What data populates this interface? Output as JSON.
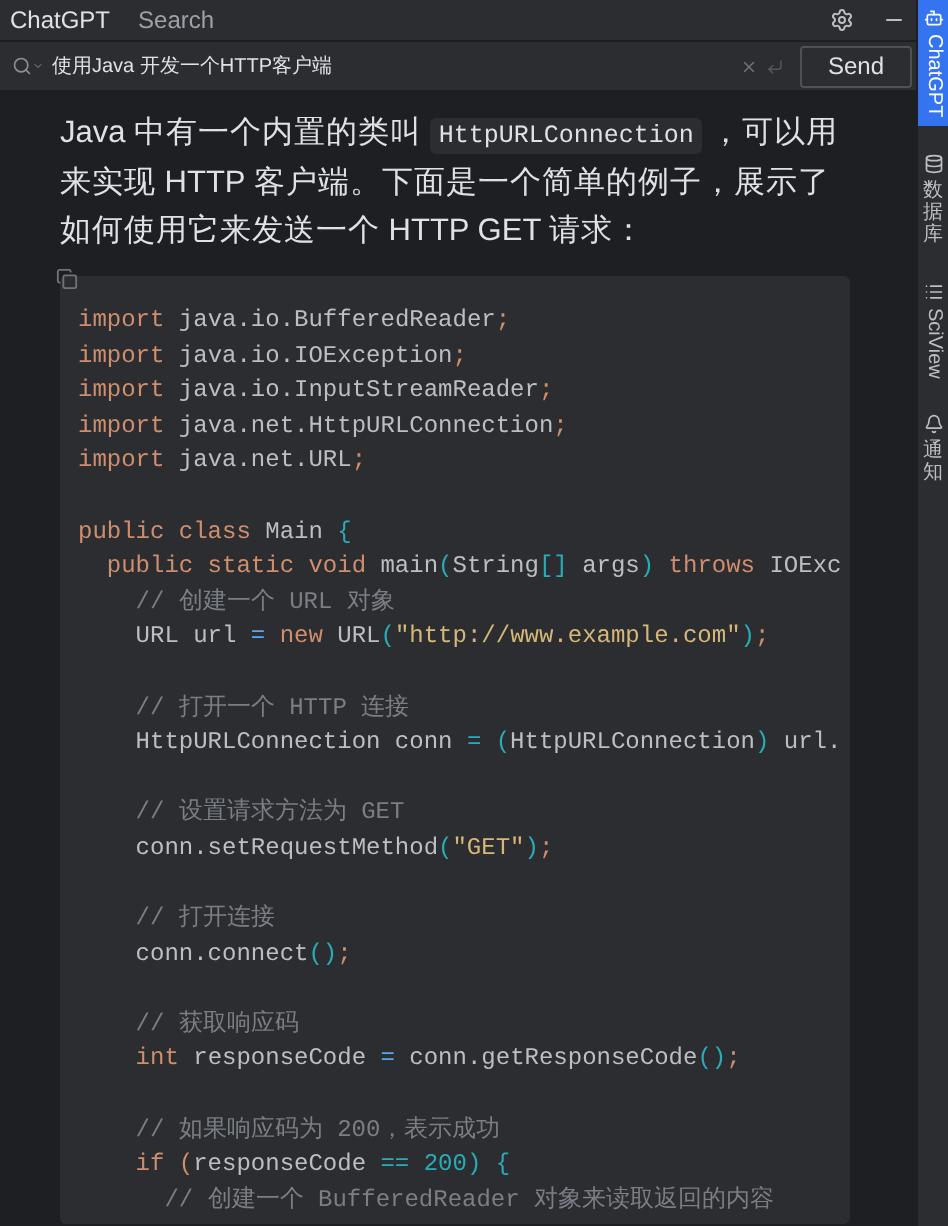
{
  "header": {
    "tabs": [
      {
        "label": "ChatGPT",
        "selected": true
      },
      {
        "label": "Search",
        "selected": false
      }
    ]
  },
  "search": {
    "value": "使用Java 开发一个HTTP客户端",
    "send": "Send"
  },
  "message": {
    "paragraph": [
      {
        "kind": "text",
        "text": "Java 中有一个内置的类叫 "
      },
      {
        "kind": "code",
        "text": "HttpURLConnection"
      },
      {
        "kind": "text",
        "text": " ，可以用来实现 HTTP 客户端。下面是一个简单的例子，展示了如何使用它来发送一个 HTTP GET 请求："
      }
    ],
    "code_lines": [
      {
        "kind": "code",
        "tokens": [
          {
            "text": "import",
            "kind": "kw"
          },
          {
            "text": " java.io.BufferedReader",
            "kind": "id"
          },
          {
            "text": ";",
            "kind": "pn"
          }
        ]
      },
      {
        "kind": "code",
        "tokens": [
          {
            "text": "import",
            "kind": "kw"
          },
          {
            "text": " java.io.IOException",
            "kind": "id"
          },
          {
            "text": ";",
            "kind": "pn"
          }
        ]
      },
      {
        "kind": "code",
        "tokens": [
          {
            "text": "import",
            "kind": "kw"
          },
          {
            "text": " java.io.InputStreamReader",
            "kind": "id"
          },
          {
            "text": ";",
            "kind": "pn"
          }
        ]
      },
      {
        "kind": "code",
        "tokens": [
          {
            "text": "import",
            "kind": "kw"
          },
          {
            "text": " java.net.HttpURLConnection",
            "kind": "id"
          },
          {
            "text": ";",
            "kind": "pn"
          }
        ]
      },
      {
        "kind": "code",
        "tokens": [
          {
            "text": "import",
            "kind": "kw"
          },
          {
            "text": " java.net.URL",
            "kind": "id"
          },
          {
            "text": ";",
            "kind": "pn"
          }
        ]
      },
      {
        "kind": "blank"
      },
      {
        "kind": "code",
        "tokens": [
          {
            "text": "public class",
            "kind": "kw"
          },
          {
            "text": " Main ",
            "kind": "id"
          },
          {
            "text": "{",
            "kind": "br"
          }
        ]
      },
      {
        "kind": "code",
        "tokens": [
          {
            "text": "  public static void",
            "kind": "kw"
          },
          {
            "text": " main",
            "kind": "id"
          },
          {
            "text": "(",
            "kind": "br"
          },
          {
            "text": "String",
            "kind": "id"
          },
          {
            "text": "[]",
            "kind": "br"
          },
          {
            "text": " args",
            "kind": "id"
          },
          {
            "text": ") ",
            "kind": "br"
          },
          {
            "text": "throws",
            "kind": "kw"
          },
          {
            "text": " IOExc",
            "kind": "id"
          }
        ]
      },
      {
        "kind": "code",
        "tokens": [
          {
            "text": "    // 创建一个 URL 对象",
            "kind": "cm"
          }
        ]
      },
      {
        "kind": "code",
        "tokens": [
          {
            "text": "    URL url ",
            "kind": "id"
          },
          {
            "text": "=",
            "kind": "op"
          },
          {
            "text": " new",
            "kind": "kw"
          },
          {
            "text": " URL",
            "kind": "id"
          },
          {
            "text": "(",
            "kind": "br"
          },
          {
            "text": "\"http://www.example.com\"",
            "kind": "str"
          },
          {
            "text": ")",
            "kind": "br"
          },
          {
            "text": ";",
            "kind": "pn"
          }
        ]
      },
      {
        "kind": "blank"
      },
      {
        "kind": "code",
        "tokens": [
          {
            "text": "    // 打开一个 HTTP 连接",
            "kind": "cm"
          }
        ]
      },
      {
        "kind": "code",
        "tokens": [
          {
            "text": "    HttpURLConnection conn ",
            "kind": "id"
          },
          {
            "text": "= (",
            "kind": "br"
          },
          {
            "text": "HttpURLConnection",
            "kind": "id"
          },
          {
            "text": ")",
            "kind": "br"
          },
          {
            "text": " url.",
            "kind": "id"
          }
        ]
      },
      {
        "kind": "blank"
      },
      {
        "kind": "code",
        "tokens": [
          {
            "text": "    // 设置请求方法为 GET",
            "kind": "cm"
          }
        ]
      },
      {
        "kind": "code",
        "tokens": [
          {
            "text": "    conn.setRequestMethod",
            "kind": "id"
          },
          {
            "text": "(",
            "kind": "br"
          },
          {
            "text": "\"GET\"",
            "kind": "str"
          },
          {
            "text": ")",
            "kind": "br"
          },
          {
            "text": ";",
            "kind": "pn"
          }
        ]
      },
      {
        "kind": "blank"
      },
      {
        "kind": "code",
        "tokens": [
          {
            "text": "    // 打开连接",
            "kind": "cm"
          }
        ]
      },
      {
        "kind": "code",
        "tokens": [
          {
            "text": "    conn.connect",
            "kind": "id"
          },
          {
            "text": "()",
            "kind": "br"
          },
          {
            "text": ";",
            "kind": "pn"
          }
        ]
      },
      {
        "kind": "blank"
      },
      {
        "kind": "code",
        "tokens": [
          {
            "text": "    // 获取响应码",
            "kind": "cm"
          }
        ]
      },
      {
        "kind": "code",
        "tokens": [
          {
            "text": "    int",
            "kind": "kw"
          },
          {
            "text": " responseCode ",
            "kind": "id"
          },
          {
            "text": "=",
            "kind": "op"
          },
          {
            "text": " conn.getResponseCode",
            "kind": "id"
          },
          {
            "text": "()",
            "kind": "br"
          },
          {
            "text": ";",
            "kind": "pn"
          }
        ]
      },
      {
        "kind": "blank"
      },
      {
        "kind": "code",
        "tokens": [
          {
            "text": "    // 如果响应码为 200，表示成功",
            "kind": "cm"
          }
        ]
      },
      {
        "kind": "code",
        "tokens": [
          {
            "text": "    if (",
            "kind": "kw"
          },
          {
            "text": "responseCode ",
            "kind": "id"
          },
          {
            "text": "== 200) {",
            "kind": "br"
          }
        ]
      },
      {
        "kind": "code",
        "tokens": [
          {
            "text": "      // 创建一个 BufferedReader 对象来读取返回的内容",
            "kind": "cm"
          }
        ]
      }
    ]
  },
  "side_tabs": [
    {
      "label": "ChatGPT",
      "kind": "latin",
      "selected": true
    },
    {
      "label": "数据库",
      "kind": "cjk",
      "selected": false
    },
    {
      "label": "SciView",
      "kind": "latin",
      "selected": false
    },
    {
      "label": "通知",
      "kind": "cjk",
      "selected": false
    }
  ]
}
